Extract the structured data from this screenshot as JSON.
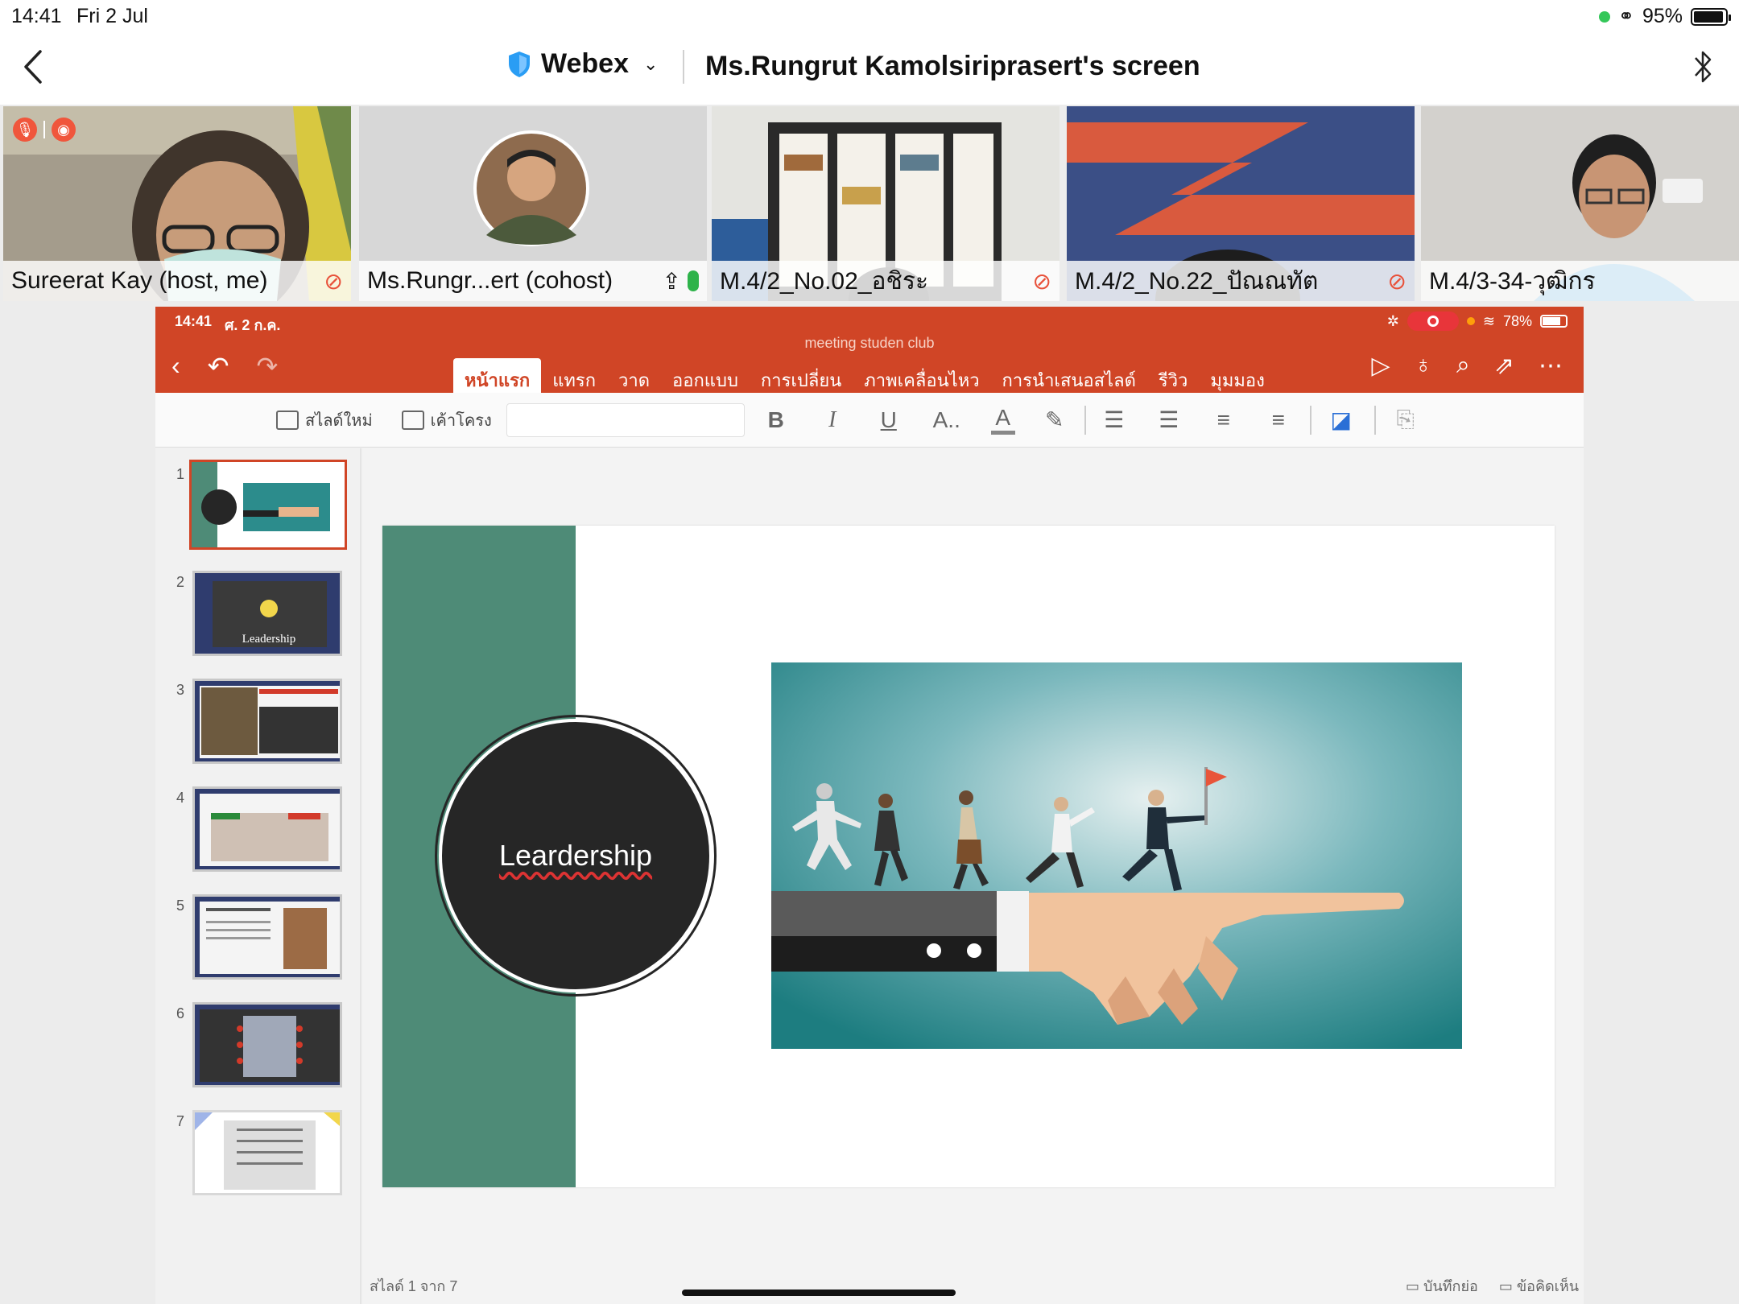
{
  "status_bar": {
    "time": "14:41",
    "date": "Fri 2 Jul",
    "battery": "95%",
    "battery_level": 0.95
  },
  "header": {
    "app_name": "Webex",
    "title": "Ms.Rungrut Kamolsiriprasert's screen"
  },
  "participants": [
    {
      "name": "Sureerat Kay (host, me)",
      "mic": "muted"
    },
    {
      "name": "Ms.Rungr...ert (cohost)",
      "mic": "on",
      "sharing": true
    },
    {
      "name": "M.4/2_No.02_อชิระ",
      "mic": "muted"
    },
    {
      "name": "M.4/2_No.22_ปัณณทัต",
      "mic": "muted"
    },
    {
      "name": "M.4/3-34-วุฒิกร",
      "mic": ""
    }
  ],
  "shared_screen": {
    "status": {
      "time": "14:41",
      "date": "ศ. 2 ก.ค.",
      "battery": "78%",
      "battery_level": 0.78
    },
    "document_title": "meeting studen club",
    "tabs": [
      "หน้าแรก",
      "แทรก",
      "วาด",
      "ออกแบบ",
      "การเปลี่ยน",
      "ภาพเคลื่อนไหว",
      "การนำเสนอสไลด์",
      "รีวิว",
      "มุมมอง"
    ],
    "active_tab": "หน้าแรก",
    "ribbon": {
      "new_slide": "สไลด์ใหม่",
      "layout": "เค้าโครง",
      "bold": "B",
      "italic": "I",
      "underline": "U",
      "font_size": "A..",
      "font_color": "A"
    },
    "thumbnails": [
      {
        "num": "1",
        "selected": true
      },
      {
        "num": "2",
        "text": "Leadership"
      },
      {
        "num": "3"
      },
      {
        "num": "4"
      },
      {
        "num": "5"
      },
      {
        "num": "6"
      },
      {
        "num": "7"
      }
    ],
    "slide": {
      "title": "Leardership"
    },
    "footer": {
      "slide_counter": "สไลด์ 1 จาก 7",
      "notes": "บันทึกย่อ",
      "comments": "ข้อคิดเห็น"
    }
  },
  "colors": {
    "powerpoint_accent": "#d04526",
    "slide_bar": "#4e8b77",
    "webex_shield": "#2a9df4"
  }
}
